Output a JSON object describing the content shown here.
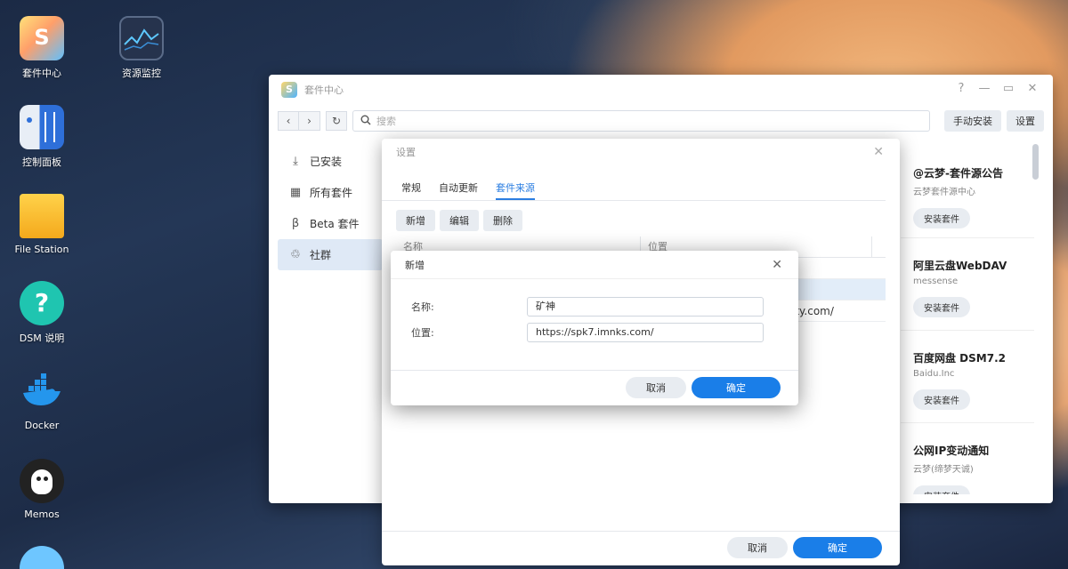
{
  "desktop": {
    "icons": [
      {
        "label": "套件中心"
      },
      {
        "label": "资源监控"
      },
      {
        "label": "控制面板"
      },
      {
        "label": "File Station"
      },
      {
        "label": "DSM 说明"
      },
      {
        "label": "Docker"
      },
      {
        "label": "Memos"
      }
    ]
  },
  "window": {
    "title": "套件中心",
    "controls": {
      "help": "?",
      "minimize": "—",
      "maximize": "▭",
      "close": "✕"
    },
    "search_placeholder": "搜索",
    "manual_install": "手动安装",
    "settings": "设置",
    "sidebar": [
      {
        "label": "已安装",
        "icon": "download-icon"
      },
      {
        "label": "所有套件",
        "icon": "grid-icon"
      },
      {
        "label": "Beta 套件",
        "icon": "beta-icon"
      },
      {
        "label": "社群",
        "icon": "community-icon"
      }
    ],
    "cards": [
      {
        "title": "@云梦-套件源公告",
        "sub": "云梦套件源中心",
        "btn": "安装套件"
      },
      {
        "title": "阿里云盘WebDAV",
        "sub": "messense",
        "btn": "安装套件"
      },
      {
        "title": "百度网盘 DSM7.2",
        "sub": "Baidu.Inc",
        "btn": "安装套件"
      },
      {
        "title": "公网IP变动通知",
        "sub": "云梦(缔梦天诚)",
        "btn": "安装套件"
      }
    ]
  },
  "settings_dialog": {
    "title": "设置",
    "tabs": [
      "常规",
      "自动更新",
      "套件来源"
    ],
    "active_tab": "套件来源",
    "actions": [
      "新增",
      "编辑",
      "删除"
    ],
    "columns": [
      "名称",
      "位置"
    ],
    "rows": [
      {
        "name": "",
        "location": ""
      },
      {
        "name": "",
        "location": ""
      },
      {
        "name": "",
        "location": "ity.com/"
      }
    ],
    "cancel": "取消",
    "ok": "确定"
  },
  "add_dialog": {
    "title": "新增",
    "name_label": "名称:",
    "name_value": "矿神",
    "location_label": "位置:",
    "location_value": "https://spk7.imnks.com/",
    "cancel": "取消",
    "ok": "确定"
  },
  "colors": {
    "accent": "#1a7ee8",
    "active_tab": "#2a7de1",
    "selected_row": "#e2edf9"
  }
}
